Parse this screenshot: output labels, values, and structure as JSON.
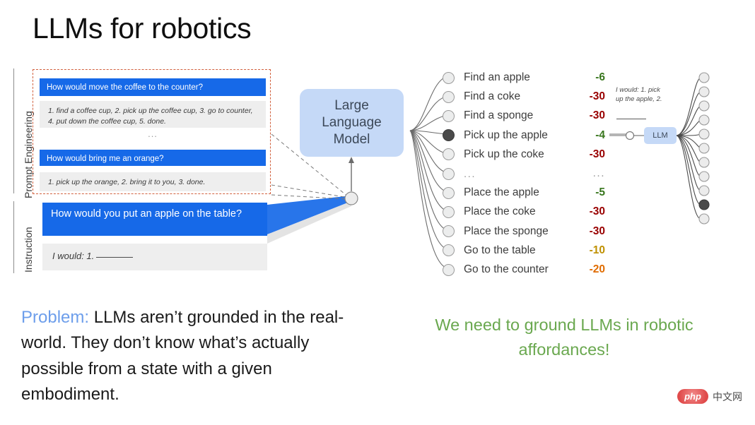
{
  "slide": {
    "title": "LLMs for robotics"
  },
  "side_labels": {
    "prompt": "Prompt Engineering",
    "instruction": "Instruction"
  },
  "prompt_examples": [
    {
      "question": "How would move the coffee to the counter?",
      "answer": "1. find a coffee cup, 2. pick up the coffee cup, 3. go to counter, 4. put down the coffee cup, 5. done."
    },
    {
      "question": "How would bring me an orange?",
      "answer": "1. pick up the orange, 2. bring it to you, 3. done."
    }
  ],
  "prompt_ellipsis": "...",
  "instruction": {
    "question": "How would you put an apple on the table?",
    "answer_prefix": "I would: 1."
  },
  "llm_box": {
    "line1": "Large",
    "line2": "Language",
    "line3": "Model"
  },
  "llm_small": {
    "label": "LLM"
  },
  "right_panel": {
    "note": "I would: 1. pick up the apple, 2."
  },
  "colors": {
    "bubble_blue": "#1669e8",
    "llm_blue": "#c5d9f7",
    "dashed_border": "#d1603d",
    "score_green": "#38761d",
    "score_red": "#990000",
    "score_yellow": "#bf9000",
    "score_orange": "#e06c00",
    "problem_blue": "#6d9eeb",
    "affordance_green": "#6aa84f"
  },
  "options": [
    {
      "label": "Find an apple",
      "score": "-6",
      "color": "#38761d",
      "selected": false
    },
    {
      "label": "Find a coke",
      "score": "-30",
      "color": "#990000",
      "selected": false
    },
    {
      "label": "Find a sponge",
      "score": "-30",
      "color": "#990000",
      "selected": false
    },
    {
      "label": "Pick up the apple",
      "score": "-4",
      "color": "#38761d",
      "selected": true
    },
    {
      "label": "Pick up the coke",
      "score": "-30",
      "color": "#990000",
      "selected": false
    },
    {
      "label": "...",
      "score": "...",
      "color": "#9a9a9a",
      "selected": false
    },
    {
      "label": "Place the apple",
      "score": "-5",
      "color": "#38761d",
      "selected": false
    },
    {
      "label": "Place the coke",
      "score": "-30",
      "color": "#990000",
      "selected": false
    },
    {
      "label": "Place the sponge",
      "score": "-30",
      "color": "#990000",
      "selected": false
    },
    {
      "label": "Go to the table",
      "score": "-10",
      "color": "#bf9000",
      "selected": false
    },
    {
      "label": "Go to the counter",
      "score": "-20",
      "color": "#e06c00",
      "selected": false
    }
  ],
  "bottom": {
    "problem_keyword": "Problem:",
    "problem_text": " LLMs aren’t grounded in the real-world. They don’t know what’s actually possible from a state with a given embodiment.",
    "affordance_text": "We need to ground LLMs in robotic affordances!"
  },
  "watermark": {
    "logo_text": "php",
    "site_text": "中文网"
  }
}
